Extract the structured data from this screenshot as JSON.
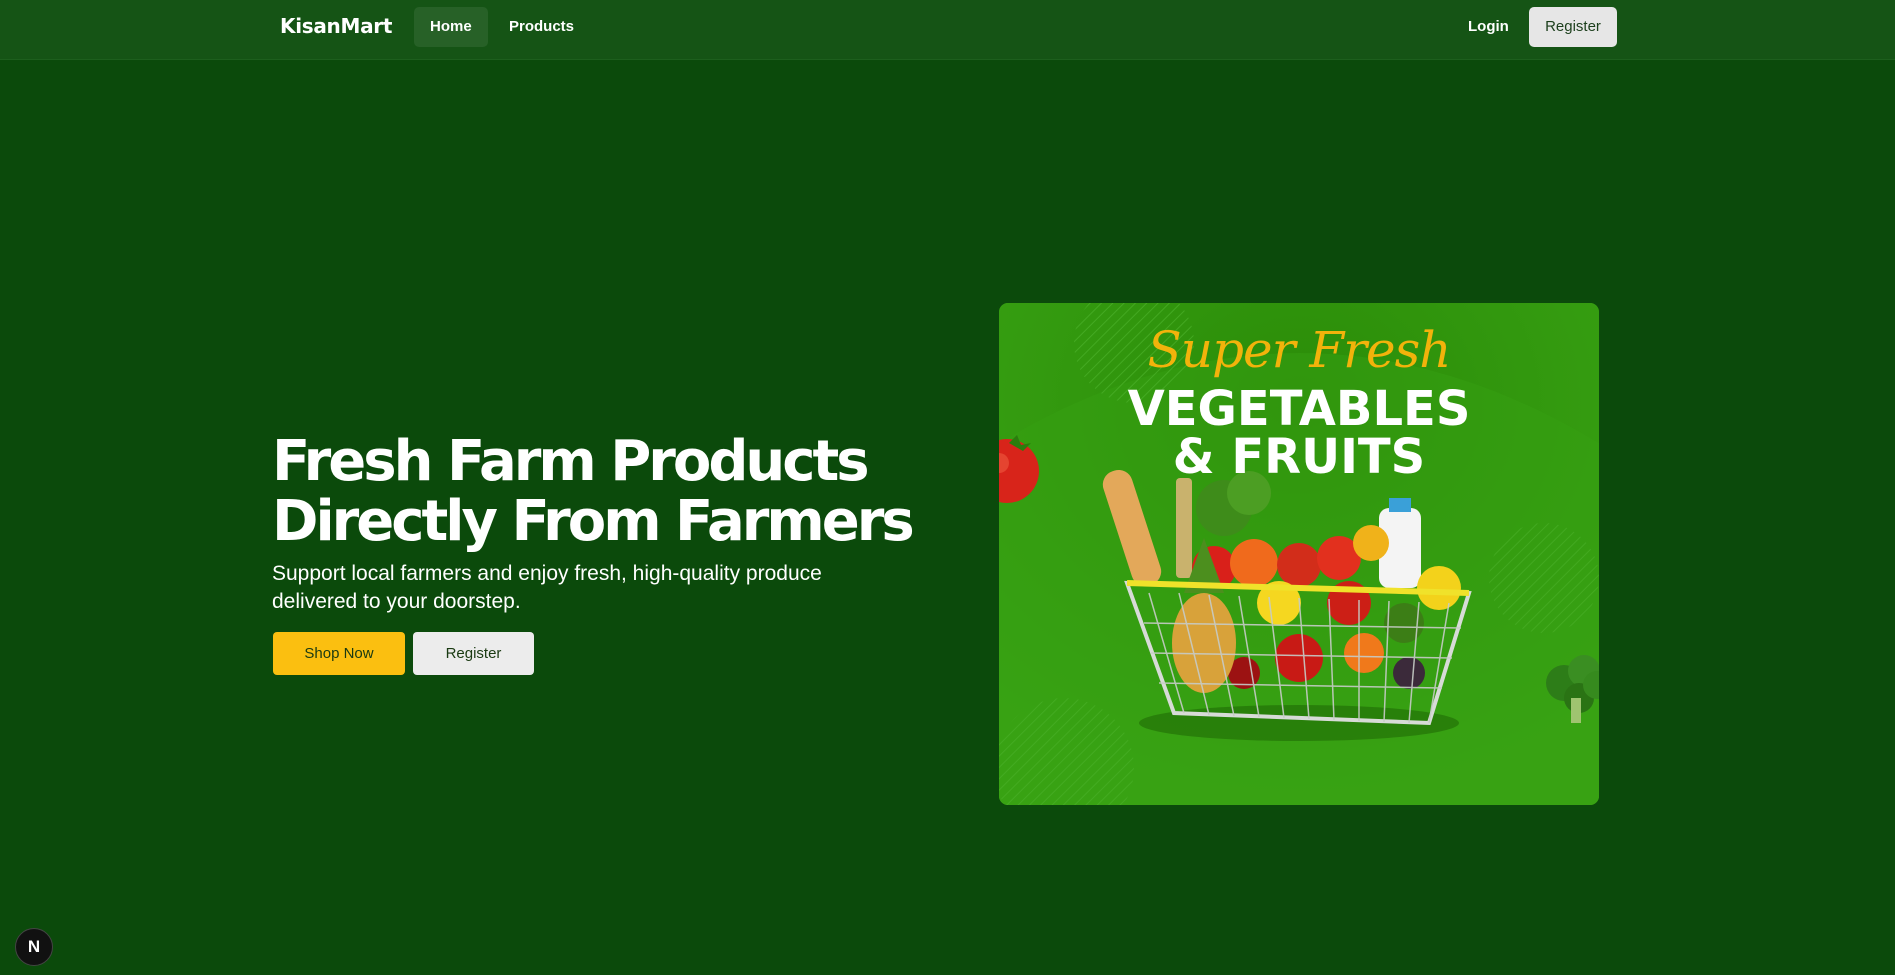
{
  "nav": {
    "brand": "KisanMart",
    "links": [
      {
        "label": "Home",
        "active": true
      },
      {
        "label": "Products",
        "active": false
      }
    ],
    "login_label": "Login",
    "register_label": "Register"
  },
  "hero": {
    "title_line1": "Fresh Farm Products",
    "title_line2": "Directly From Farmers",
    "subtitle_line1": "Support local farmers and enjoy fresh, high-quality produce",
    "subtitle_line2": "delivered to your doorstep.",
    "shop_now_label": "Shop Now",
    "register_label": "Register"
  },
  "banner": {
    "script_text": "Super Fresh",
    "line1": "VEGETABLES",
    "line2": "& FRUITS"
  },
  "badge": {
    "label": "N"
  },
  "colors": {
    "page_bg": "#0b4a0b",
    "nav_bg": "#155415",
    "accent_yellow": "#fbbf10",
    "banner_green": "#2d8f09"
  }
}
